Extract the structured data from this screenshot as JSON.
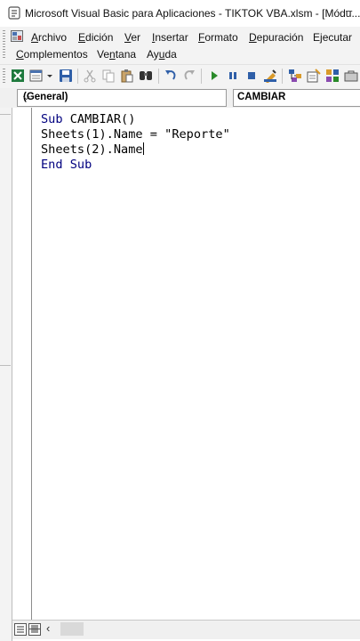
{
  "window": {
    "title": "Microsoft Visual Basic para Aplicaciones - TIKTOK VBA.xlsm - [Módu...",
    "minimize_glyph": "–"
  },
  "menu": {
    "row1": [
      {
        "label": "Archivo",
        "mnemonic": "A",
        "rest": "rchivo"
      },
      {
        "label": "Edición",
        "mnemonic": "E",
        "rest": "dición"
      },
      {
        "label": "Ver",
        "mnemonic": "V",
        "rest": "er"
      },
      {
        "label": "Insertar",
        "mnemonic": "I",
        "rest": "nsertar"
      },
      {
        "label": "Formato",
        "mnemonic": "F",
        "rest": "ormato"
      },
      {
        "label": "Depuración",
        "mnemonic": "D",
        "rest": "epuración"
      },
      {
        "label": "Ejecutar",
        "pre": "E",
        "mnemonic": "j",
        "rest": "ecutar"
      }
    ],
    "row2": [
      {
        "label": "Complementos",
        "mnemonic": "C",
        "rest": "omplementos"
      },
      {
        "label": "Ventana",
        "pre": "Ve",
        "mnemonic": "n",
        "rest": "tana"
      },
      {
        "label": "Ayuda",
        "pre": "Ay",
        "mnemonic": "u",
        "rest": "da"
      }
    ]
  },
  "toolbar": {
    "icons": [
      "excel-view-icon",
      "insert-module-icon",
      "save-icon",
      "cut-icon",
      "copy-icon",
      "paste-icon",
      "find-icon",
      "undo-icon",
      "redo-icon",
      "run-icon",
      "break-icon",
      "reset-icon",
      "design-mode-icon",
      "project-explorer-icon",
      "properties-icon",
      "object-browser-icon"
    ]
  },
  "code_window": {
    "object_combo": "(General)",
    "procedure_combo": "CAMBIAR",
    "dropdown_glyph": "⌵",
    "lines": [
      {
        "kw": "Sub",
        "text": " CAMBIAR()"
      },
      {
        "kw": "",
        "text": "Sheets(1).Name = \"Reporte\""
      },
      {
        "kw": "",
        "text": "Sheets(2).Name"
      },
      {
        "kw": "End Sub",
        "text": ""
      }
    ],
    "scroll_left_glyph": "‹"
  },
  "colors": {
    "keyword": "#00007f",
    "toolbar_bg": "#f3f3f3"
  }
}
